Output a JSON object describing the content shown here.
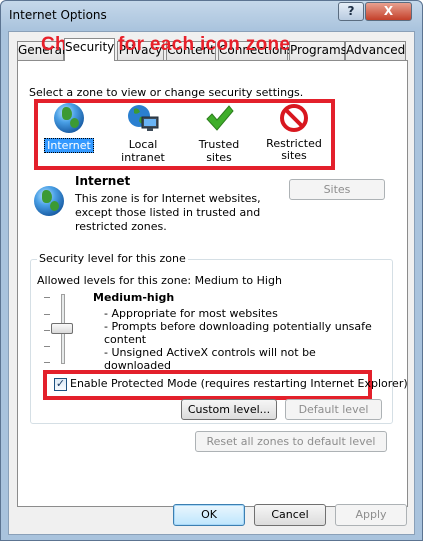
{
  "window": {
    "title": "Internet Options",
    "help_label": "?",
    "close_label": "X"
  },
  "tabs": [
    {
      "label": "General"
    },
    {
      "label": "Security"
    },
    {
      "label": "Privacy"
    },
    {
      "label": "Content"
    },
    {
      "label": "Connections"
    },
    {
      "label": "Programs"
    },
    {
      "label": "Advanced"
    }
  ],
  "annotation": "Change for each icon zone",
  "instruction": "Select a zone to view or change security settings.",
  "zones": [
    {
      "label": "Internet",
      "icon": "globe-icon"
    },
    {
      "label": "Local intranet",
      "icon": "intranet-icon"
    },
    {
      "label": "Trusted sites",
      "icon": "checkmark-icon"
    },
    {
      "label": "Restricted sites",
      "label_line1": "Restricted",
      "label_line2": "sites",
      "icon": "no-entry-icon"
    }
  ],
  "zone_info": {
    "title": "Internet",
    "desc_lines": [
      "This zone is for Internet websites,",
      "except those listed in trusted and",
      "restricted zones."
    ],
    "sites_label": "Sites"
  },
  "security_level": {
    "legend": "Security level for this zone",
    "allowed": "Allowed levels for this zone: Medium to High",
    "level_name": "Medium-high",
    "bullets": [
      "- Appropriate for most websites",
      "- Prompts before downloading potentially unsafe",
      "content",
      "- Unsigned ActiveX controls will not be downloaded"
    ],
    "protected_mode_label": "Enable Protected Mode (requires restarting Internet Explorer)",
    "protected_mode_checked": true,
    "custom_level_label": "Custom level...",
    "default_level_label": "Default level",
    "reset_label": "Reset all zones to default level"
  },
  "footer": {
    "ok_label": "OK",
    "cancel_label": "Cancel",
    "apply_label": "Apply"
  },
  "colors": {
    "annotation_red": "#e3202b",
    "selection_blue": "#3399ff"
  }
}
